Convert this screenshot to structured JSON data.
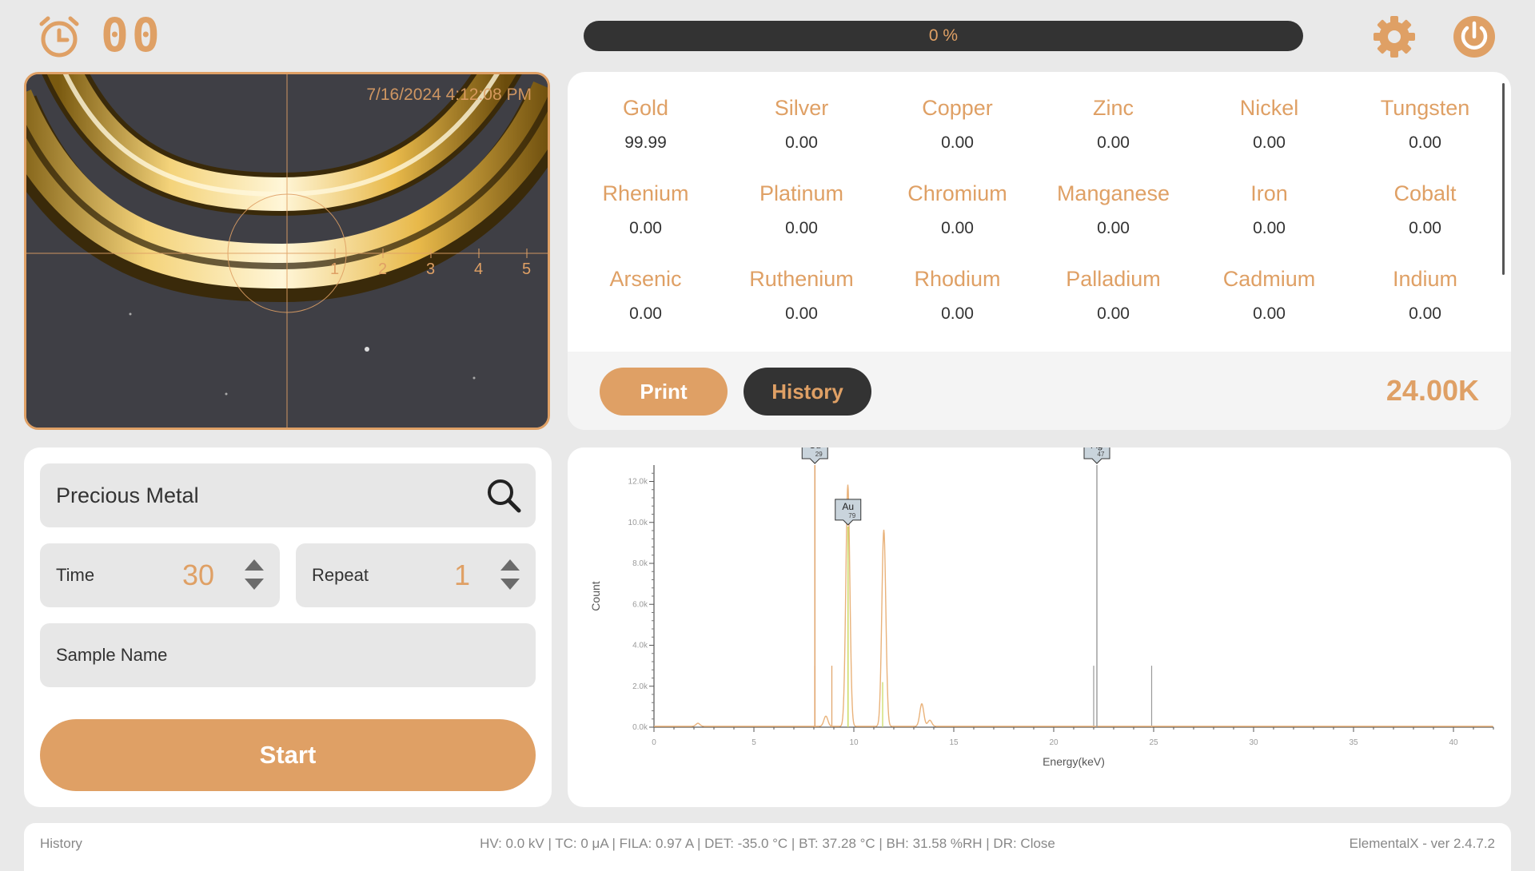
{
  "timer": {
    "display": "00"
  },
  "progress": {
    "text": "0 %",
    "fraction": 0
  },
  "icons": {
    "timer": "alarm-clock-icon",
    "settings": "gear-icon",
    "power": "power-icon",
    "search": "search-icon"
  },
  "camera": {
    "timestamp": "7/16/2024 4:12:08 PM",
    "ruler_labels": [
      "1",
      "2",
      "3",
      "4",
      "5"
    ]
  },
  "elements": [
    {
      "name": "Gold",
      "value": "99.99"
    },
    {
      "name": "Silver",
      "value": "0.00"
    },
    {
      "name": "Copper",
      "value": "0.00"
    },
    {
      "name": "Zinc",
      "value": "0.00"
    },
    {
      "name": "Nickel",
      "value": "0.00"
    },
    {
      "name": "Tungsten",
      "value": "0.00"
    },
    {
      "name": "Rhenium",
      "value": "0.00"
    },
    {
      "name": "Platinum",
      "value": "0.00"
    },
    {
      "name": "Chromium",
      "value": "0.00"
    },
    {
      "name": "Manganese",
      "value": "0.00"
    },
    {
      "name": "Iron",
      "value": "0.00"
    },
    {
      "name": "Cobalt",
      "value": "0.00"
    },
    {
      "name": "Arsenic",
      "value": "0.00"
    },
    {
      "name": "Ruthenium",
      "value": "0.00"
    },
    {
      "name": "Rhodium",
      "value": "0.00"
    },
    {
      "name": "Palladium",
      "value": "0.00"
    },
    {
      "name": "Cadmium",
      "value": "0.00"
    },
    {
      "name": "Indium",
      "value": "0.00"
    }
  ],
  "actions": {
    "print_label": "Print",
    "history_label": "History",
    "count_rate": "24.00K"
  },
  "controls": {
    "method": "Precious Metal",
    "time_label": "Time",
    "time_value": "30",
    "repeat_label": "Repeat",
    "repeat_value": "1",
    "sample_placeholder": "Sample Name",
    "start_label": "Start"
  },
  "chart_data": {
    "type": "line",
    "xlabel": "Energy(keV)",
    "ylabel": "Count",
    "xlim": [
      0,
      42
    ],
    "ylim": [
      0,
      12800
    ],
    "x_ticks": [
      0,
      5,
      10,
      15,
      20,
      25,
      30,
      35,
      40
    ],
    "x_tick_labels": [
      "0",
      "5",
      "10",
      "15",
      "20",
      "25",
      "30",
      "35",
      "40"
    ],
    "y_ticks": [
      0,
      2000,
      4000,
      6000,
      8000,
      10000,
      12000
    ],
    "y_tick_labels": [
      "0.0k",
      "2.0k",
      "4.0k",
      "6.0k",
      "8.0k",
      "10.0k",
      "12.0k"
    ],
    "peaks": [
      {
        "energy": 2.2,
        "height": 150
      },
      {
        "energy": 8.6,
        "height": 500
      },
      {
        "energy": 9.7,
        "height": 11800
      },
      {
        "energy": 11.5,
        "height": 9600
      },
      {
        "energy": 13.4,
        "height": 1100
      },
      {
        "energy": 13.8,
        "height": 300
      }
    ],
    "markers": [
      {
        "symbol": "Cu",
        "z": "29",
        "energy": 8.05,
        "count": 12800,
        "color": "#dfa065"
      },
      {
        "symbol": "Au",
        "z": "79",
        "energy": 9.71,
        "count": 9800,
        "color": "#c8d85a"
      },
      {
        "symbol": "Ag",
        "z": "47",
        "energy": 22.16,
        "count": 12800,
        "color": "#9a9a9a"
      }
    ],
    "reference_lines": [
      {
        "energy": 8.05,
        "count": 3000,
        "color": "#dfa065"
      },
      {
        "energy": 8.9,
        "count": 3000,
        "color": "#dfa065"
      },
      {
        "energy": 11.44,
        "count": 2200,
        "color": "#c8d85a"
      },
      {
        "energy": 22.0,
        "count": 3000,
        "color": "#9a9a9a"
      },
      {
        "energy": 24.9,
        "count": 3000,
        "color": "#9a9a9a"
      }
    ]
  },
  "status": {
    "history_label": "History",
    "readings": "HV: 0.0 kV | TC: 0 μA | FILA: 0.97 A | DET: -35.0 °C | BT: 37.28 °C | BH: 31.58 %RH | DR: Close",
    "version": "ElementalX - ver 2.4.7.2"
  }
}
